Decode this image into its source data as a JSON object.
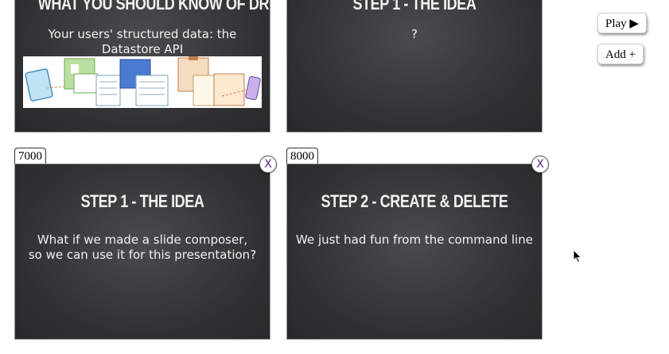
{
  "slides": [
    {
      "title": "WHAT YOU SHOULD KNOW OF DROPBOX",
      "body": "Your users' structured data: the Datastore API"
    },
    {
      "title": "STEP 1 - THE IDEA",
      "body": "?"
    },
    {
      "number": "7000",
      "title": "STEP 1 - THE IDEA",
      "body_line1": "What if we made a slide composer,",
      "body_line2": "so we can use it for this presentation?",
      "close_label": "X"
    },
    {
      "number": "8000",
      "title": "STEP 2 - CREATE & DELETE",
      "body": "We just had fun from the command line",
      "close_label": "X"
    }
  ],
  "controls": {
    "play_label": "Play ▶",
    "add_label": "Add +"
  },
  "colors": {
    "slide_bg": "#3a3b3d",
    "slide_text": "#f2f2f2",
    "close_x": "#4a2a8a"
  }
}
